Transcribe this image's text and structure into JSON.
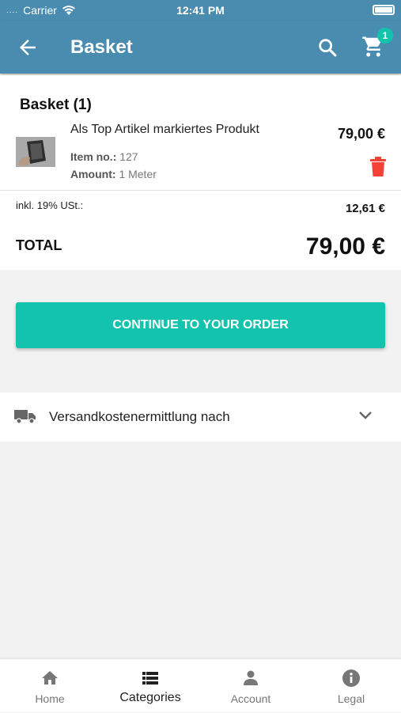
{
  "status_bar": {
    "carrier": "Carrier",
    "time": "12:41 PM"
  },
  "app_bar": {
    "title": "Basket",
    "cart_count": "1"
  },
  "basket": {
    "heading": "Basket (1)",
    "item": {
      "name": "Als Top Artikel markiertes Produkt",
      "price": "79,00 €",
      "item_no_label": "Item no.:",
      "item_no_value": "127",
      "amount_label": "Amount:",
      "amount_value": "1 Meter"
    },
    "tax_label": "inkl. 19% USt.:",
    "tax_value": "12,61 €",
    "total_label": "TOTAL",
    "total_value": "79,00 €"
  },
  "continue_label": "CONTINUE TO YOUR ORDER",
  "shipping": {
    "label": "Versandkostenermittlung nach"
  },
  "bottom_nav": [
    {
      "label": "Home",
      "icon": "home-icon"
    },
    {
      "label": "Categories",
      "icon": "list-icon"
    },
    {
      "label": "Account",
      "icon": "person-icon"
    },
    {
      "label": "Legal",
      "icon": "info-icon"
    }
  ],
  "colors": {
    "primary": "#4a8cb0",
    "accent": "#14c3ad",
    "danger": "#f44336"
  }
}
